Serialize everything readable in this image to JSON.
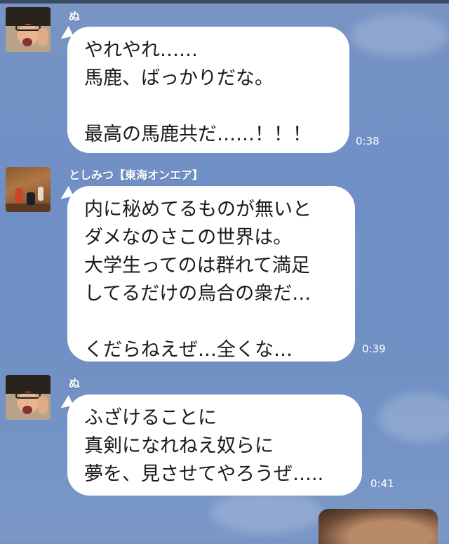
{
  "messages": [
    {
      "sender": "ぬ",
      "avatar_icon": "person-glasses-avatar",
      "lines": [
        "やれやれ……",
        "馬鹿、ばっかりだな。",
        "",
        "最高の馬鹿共だ……！！！"
      ],
      "time": "0:38"
    },
    {
      "sender": "としみつ【東海オンエア】",
      "avatar_icon": "gym-group-avatar",
      "lines": [
        "内に秘めてるものが無いと",
        "ダメなのさこの世界は。",
        "大学生ってのは群れて満足",
        "してるだけの烏合の衆だ…",
        "",
        "くだらねえぜ…全くな…"
      ],
      "time": "0:39"
    },
    {
      "sender": "ぬ",
      "avatar_icon": "person-glasses-avatar",
      "lines": [
        "ふざけることに",
        "真剣になれねえ奴らに",
        "夢を、見させてやろうぜ….."
      ],
      "time": "0:41"
    }
  ],
  "outgoing_photo": "image-message-thumbnail",
  "colors": {
    "background": "#7191c5",
    "bubble": "#ffffff",
    "text": "#1a1a1a",
    "meta": "#ffffff"
  }
}
